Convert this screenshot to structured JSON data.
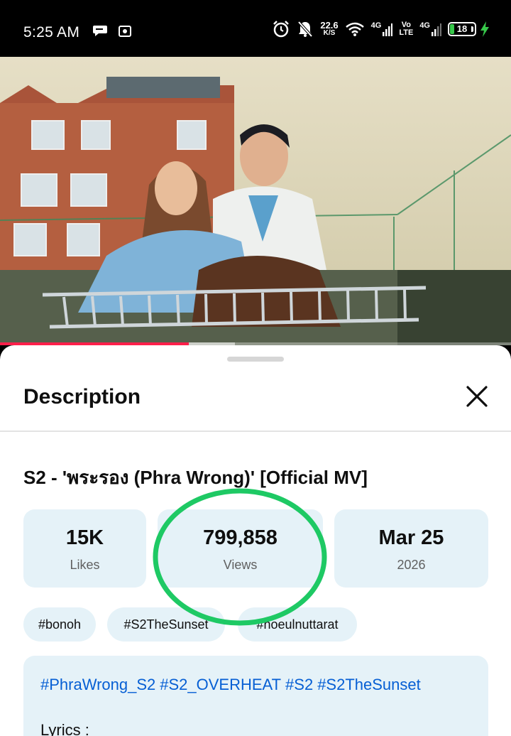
{
  "status_bar": {
    "time": "5:25 AM",
    "net_speed_value": "22.6",
    "net_speed_unit": "K/S",
    "signal1_label": "4G",
    "volte_top": "Vo",
    "volte_bottom": "LTE",
    "signal2_label": "4G",
    "battery_level": "18"
  },
  "video": {
    "progress_fraction": 0.37,
    "buffer_fraction": 0.46
  },
  "sheet": {
    "title": "Description",
    "video_title": "S2 - 'พระรอง (Phra Wrong)' [Official MV]"
  },
  "stats": [
    {
      "value": "15K",
      "label": "Likes"
    },
    {
      "value": "799,858",
      "label": "Views"
    },
    {
      "value": "Mar 25",
      "label": "2026"
    }
  ],
  "tags": [
    "#bonoh",
    "#S2TheSunset",
    "#noeulnuttarat"
  ],
  "description": {
    "hashtags": [
      "#PhraWrong_S2",
      "#S2_OVERHEAT",
      "#S2",
      "#S2TheSunset"
    ],
    "lyrics_label": "Lyrics :"
  },
  "colors": {
    "accent_red": "#ff1f4a",
    "link_blue": "#065fd4",
    "chip_bg": "#e5f2f8",
    "annotation_green": "#1ec964",
    "battery_green": "#37c84a"
  },
  "icons": [
    "chat-bubble-icon",
    "screenshot-icon",
    "alarm-icon",
    "mute-icon",
    "wifi-icon",
    "signal-icon",
    "battery-icon",
    "charging-icon",
    "close-icon"
  ]
}
